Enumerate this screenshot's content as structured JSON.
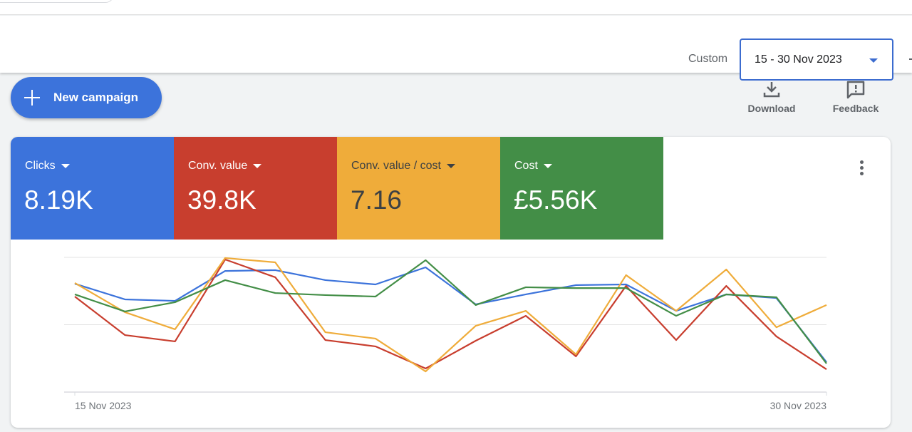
{
  "header": {
    "date_range_label": "Custom",
    "date_range_value": "15 - 30 Nov 2023"
  },
  "toolbar": {
    "new_campaign_label": "New campaign",
    "download_label": "Download",
    "feedback_label": "Feedback"
  },
  "metrics": [
    {
      "label": "Clicks",
      "value": "8.19K",
      "color": "#3c73db",
      "text_color": "#ffffff"
    },
    {
      "label": "Conv. value",
      "value": "39.8K",
      "color": "#c83e2e",
      "text_color": "#ffffff"
    },
    {
      "label": "Conv. value / cost",
      "value": "7.16",
      "color": "#efac3a",
      "text_color": "#3c4043"
    },
    {
      "label": "Cost",
      "value": "£5.56K",
      "color": "#438e47",
      "text_color": "#ffffff"
    }
  ],
  "chart_data": {
    "type": "line",
    "title": "",
    "xlabel": "",
    "ylabel": "",
    "x": [
      "15 Nov 2023",
      "16 Nov 2023",
      "17 Nov 2023",
      "18 Nov 2023",
      "19 Nov 2023",
      "20 Nov 2023",
      "21 Nov 2023",
      "22 Nov 2023",
      "23 Nov 2023",
      "24 Nov 2023",
      "25 Nov 2023",
      "26 Nov 2023",
      "27 Nov 2023",
      "28 Nov 2023",
      "29 Nov 2023",
      "30 Nov 2023"
    ],
    "x_tick_labels": [
      "15 Nov 2023",
      "30 Nov 2023"
    ],
    "y_scale_note": "relative (0-100), no y-axis tick labels shown",
    "ylim": [
      0,
      100
    ],
    "grid": true,
    "gridlines": [
      0,
      50,
      100
    ],
    "series": [
      {
        "name": "Clicks",
        "color": "#3c73db",
        "values": [
          80.4,
          68.8,
          67.7,
          89.9,
          90.5,
          83.1,
          79.9,
          92.6,
          65.1,
          72.5,
          79.4,
          79.9,
          60.3,
          72.5,
          69.8,
          22.2
        ]
      },
      {
        "name": "Conv. value",
        "color": "#c83e2e",
        "values": [
          70.9,
          42.3,
          37.6,
          98.4,
          85.2,
          38.6,
          33.9,
          17.5,
          38.1,
          56.6,
          26.5,
          78.8,
          38.6,
          78.8,
          41.3,
          16.9
        ]
      },
      {
        "name": "Conv. value / cost",
        "color": "#efac3a",
        "values": [
          81.0,
          59.3,
          46.6,
          99.5,
          96.3,
          44.4,
          39.7,
          15.3,
          49.2,
          60.3,
          28.0,
          86.8,
          60.3,
          91.0,
          48.1,
          64.6
        ]
      },
      {
        "name": "Cost",
        "color": "#438e47",
        "values": [
          72.5,
          59.8,
          66.7,
          83.1,
          73.5,
          72.0,
          70.9,
          97.9,
          64.6,
          77.8,
          77.2,
          77.2,
          56.6,
          72.5,
          70.4,
          21.2
        ]
      }
    ]
  }
}
